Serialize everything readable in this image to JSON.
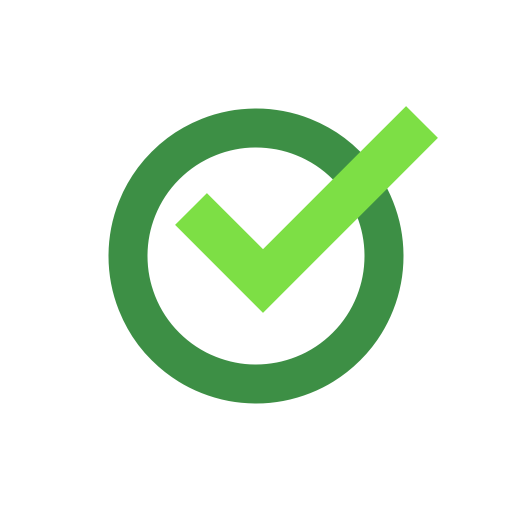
{
  "icon": {
    "name": "check-circle-icon",
    "colors": {
      "ring": "#3d8f45",
      "check": "#7ddf45",
      "background": "#ffffff"
    }
  }
}
